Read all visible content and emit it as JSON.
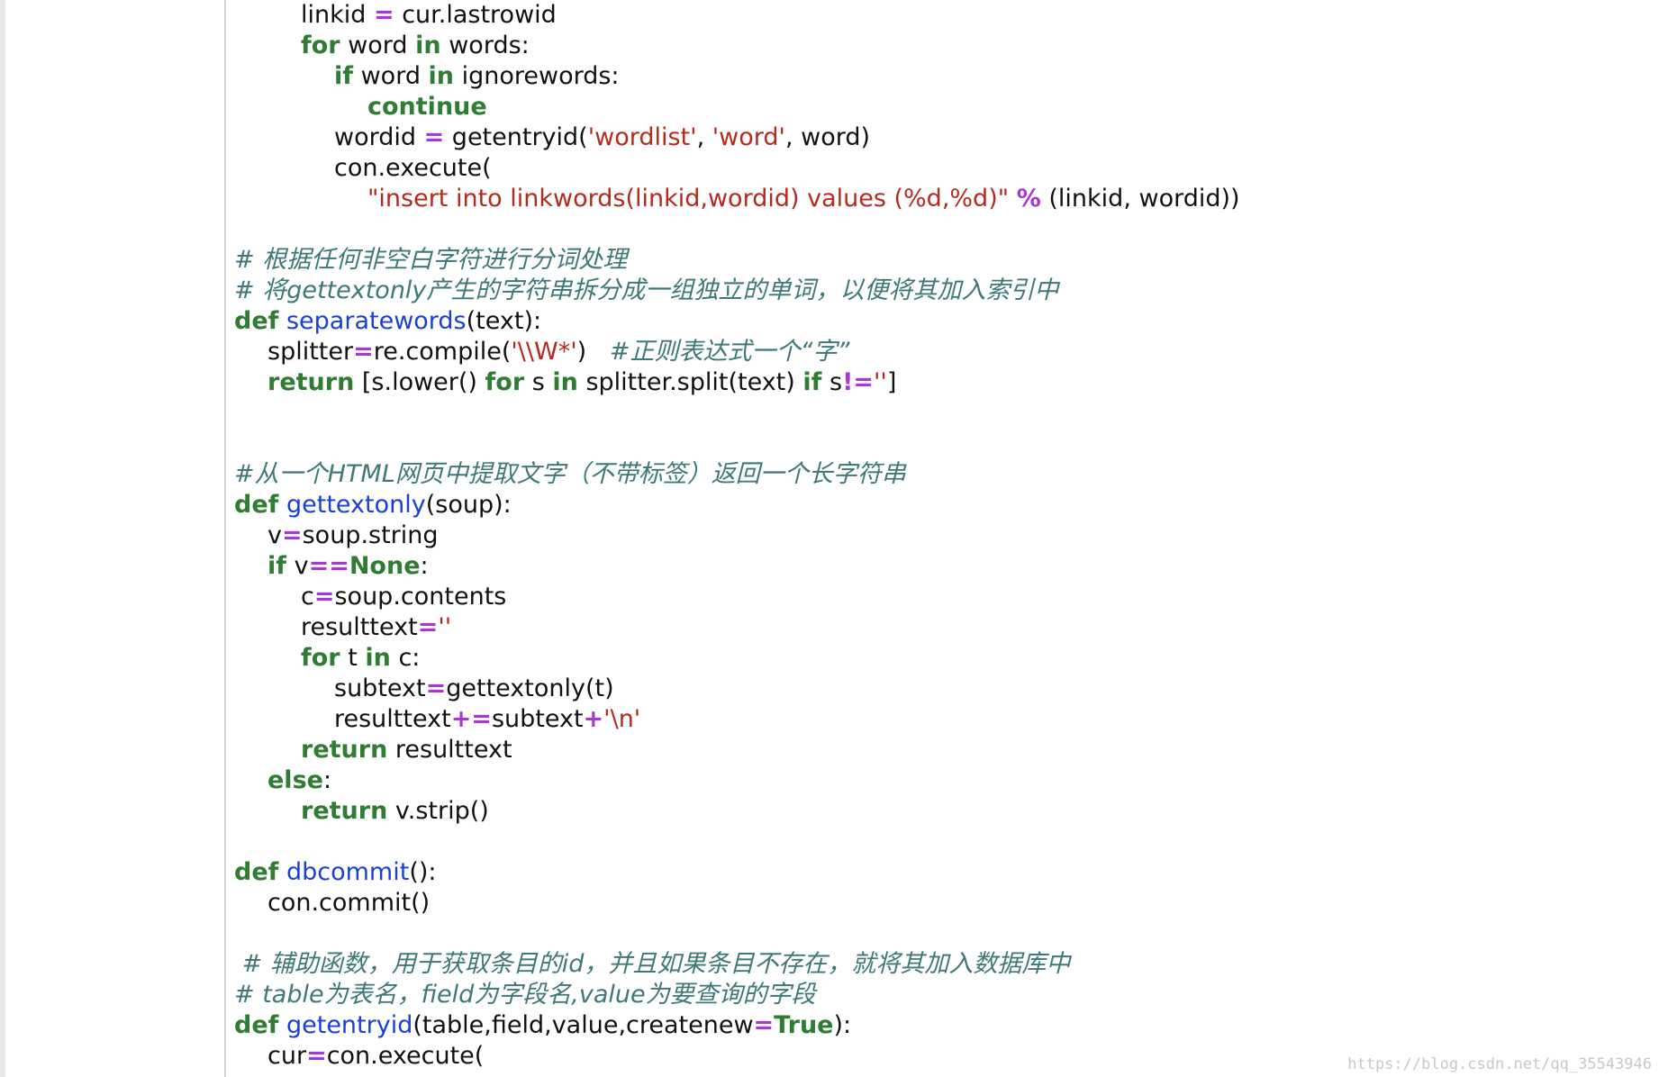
{
  "colors": {
    "keyword": "#2f7d32",
    "function_name": "#1a3fd6",
    "string": "#b52a1d",
    "operator": "#a936d6",
    "comment": "#3e7878",
    "text": "#111111"
  },
  "code_lines": [
    {
      "indent": 2,
      "tokens": [
        [
          "tx",
          "linkid "
        ],
        [
          "op",
          "="
        ],
        [
          "tx",
          " cur.lastrowid"
        ]
      ]
    },
    {
      "indent": 2,
      "tokens": [
        [
          "kw",
          "for"
        ],
        [
          "tx",
          " word "
        ],
        [
          "kw",
          "in"
        ],
        [
          "tx",
          " words:"
        ]
      ]
    },
    {
      "indent": 3,
      "tokens": [
        [
          "kw",
          "if"
        ],
        [
          "tx",
          " word "
        ],
        [
          "kw",
          "in"
        ],
        [
          "tx",
          " ignorewords:"
        ]
      ]
    },
    {
      "indent": 4,
      "tokens": [
        [
          "kw",
          "continue"
        ]
      ]
    },
    {
      "indent": 3,
      "tokens": [
        [
          "tx",
          "wordid "
        ],
        [
          "op",
          "="
        ],
        [
          "tx",
          " getentryid("
        ],
        [
          "str",
          "'wordlist'"
        ],
        [
          "tx",
          ", "
        ],
        [
          "str",
          "'word'"
        ],
        [
          "tx",
          ", word)"
        ]
      ]
    },
    {
      "indent": 3,
      "tokens": [
        [
          "tx",
          "con.execute("
        ]
      ]
    },
    {
      "indent": 4,
      "tokens": [
        [
          "str",
          "\"insert into linkwords(linkid,wordid) values (%d,%d)\""
        ],
        [
          "tx",
          " "
        ],
        [
          "op",
          "%"
        ],
        [
          "tx",
          " (linkid, wordid))"
        ]
      ]
    },
    {
      "indent": 0,
      "tokens": []
    },
    {
      "indent": 0,
      "tokens": [
        [
          "cm",
          "# 根据任何非空白字符进行分词处理"
        ]
      ]
    },
    {
      "indent": 0,
      "tokens": [
        [
          "cm",
          "# 将gettextonly产生的字符串拆分成一组独立的单词，以便将其加入索引中"
        ]
      ]
    },
    {
      "indent": 0,
      "tokens": [
        [
          "kw",
          "def"
        ],
        [
          "tx",
          " "
        ],
        [
          "fn",
          "separatewords"
        ],
        [
          "tx",
          "(text):"
        ]
      ]
    },
    {
      "indent": 1,
      "tokens": [
        [
          "tx",
          "splitter"
        ],
        [
          "op",
          "="
        ],
        [
          "tx",
          "re.compile("
        ],
        [
          "str",
          "'\\\\W*'"
        ],
        [
          "tx",
          ")   "
        ],
        [
          "cm",
          "#正则表达式一个“字”"
        ]
      ]
    },
    {
      "indent": 1,
      "tokens": [
        [
          "kw",
          "return"
        ],
        [
          "tx",
          " [s.lower() "
        ],
        [
          "kw",
          "for"
        ],
        [
          "tx",
          " s "
        ],
        [
          "kw",
          "in"
        ],
        [
          "tx",
          " splitter.split(text) "
        ],
        [
          "kw",
          "if"
        ],
        [
          "tx",
          " s"
        ],
        [
          "op",
          "!="
        ],
        [
          "str",
          "''"
        ],
        [
          "tx",
          "]"
        ]
      ]
    },
    {
      "indent": 0,
      "tokens": []
    },
    {
      "indent": 0,
      "tokens": []
    },
    {
      "indent": 0,
      "tokens": [
        [
          "cm",
          "#从一个HTML网页中提取文字（不带标签）返回一个长字符串"
        ]
      ]
    },
    {
      "indent": 0,
      "tokens": [
        [
          "kw",
          "def"
        ],
        [
          "tx",
          " "
        ],
        [
          "fn",
          "gettextonly"
        ],
        [
          "tx",
          "(soup):"
        ]
      ]
    },
    {
      "indent": 1,
      "tokens": [
        [
          "tx",
          "v"
        ],
        [
          "op",
          "="
        ],
        [
          "tx",
          "soup.string"
        ]
      ]
    },
    {
      "indent": 1,
      "tokens": [
        [
          "kw",
          "if"
        ],
        [
          "tx",
          " v"
        ],
        [
          "op",
          "=="
        ],
        [
          "kw",
          "None"
        ],
        [
          "tx",
          ":"
        ]
      ]
    },
    {
      "indent": 2,
      "tokens": [
        [
          "tx",
          "c"
        ],
        [
          "op",
          "="
        ],
        [
          "tx",
          "soup.contents"
        ]
      ]
    },
    {
      "indent": 2,
      "tokens": [
        [
          "tx",
          "resulttext"
        ],
        [
          "op",
          "="
        ],
        [
          "str",
          "''"
        ]
      ]
    },
    {
      "indent": 2,
      "tokens": [
        [
          "kw",
          "for"
        ],
        [
          "tx",
          " t "
        ],
        [
          "kw",
          "in"
        ],
        [
          "tx",
          " c:"
        ]
      ]
    },
    {
      "indent": 3,
      "tokens": [
        [
          "tx",
          "subtext"
        ],
        [
          "op",
          "="
        ],
        [
          "tx",
          "gettextonly(t)"
        ]
      ]
    },
    {
      "indent": 3,
      "tokens": [
        [
          "tx",
          "resulttext"
        ],
        [
          "op",
          "+="
        ],
        [
          "tx",
          "subtext"
        ],
        [
          "op",
          "+"
        ],
        [
          "str",
          "'\\n'"
        ]
      ]
    },
    {
      "indent": 2,
      "tokens": [
        [
          "kw",
          "return"
        ],
        [
          "tx",
          " resulttext"
        ]
      ]
    },
    {
      "indent": 1,
      "tokens": [
        [
          "kw",
          "else"
        ],
        [
          "tx",
          ":"
        ]
      ]
    },
    {
      "indent": 2,
      "tokens": [
        [
          "kw",
          "return"
        ],
        [
          "tx",
          " v.strip()"
        ]
      ]
    },
    {
      "indent": 0,
      "tokens": []
    },
    {
      "indent": 0,
      "tokens": [
        [
          "kw",
          "def"
        ],
        [
          "tx",
          " "
        ],
        [
          "fn",
          "dbcommit"
        ],
        [
          "tx",
          "():"
        ]
      ]
    },
    {
      "indent": 1,
      "tokens": [
        [
          "tx",
          "con.commit()"
        ]
      ]
    },
    {
      "indent": 0,
      "tokens": []
    },
    {
      "indent": 0,
      "tokens": [
        [
          "cm",
          " # 辅助函数，用于获取条目的id，并且如果条目不存在，就将其加入数据库中"
        ]
      ]
    },
    {
      "indent": 0,
      "tokens": [
        [
          "cm",
          "# table为表名，field为字段名,value为要查询的字段"
        ]
      ]
    },
    {
      "indent": 0,
      "tokens": [
        [
          "kw",
          "def"
        ],
        [
          "tx",
          " "
        ],
        [
          "fn",
          "getentryid"
        ],
        [
          "tx",
          "(table,field,value,createnew"
        ],
        [
          "op",
          "="
        ],
        [
          "kw",
          "True"
        ],
        [
          "tx",
          "):"
        ]
      ]
    },
    {
      "indent": 1,
      "tokens": [
        [
          "tx",
          "cur"
        ],
        [
          "op",
          "="
        ],
        [
          "tx",
          "con.execute("
        ]
      ]
    }
  ],
  "watermark": "https://blog.csdn.net/qq_35543946"
}
